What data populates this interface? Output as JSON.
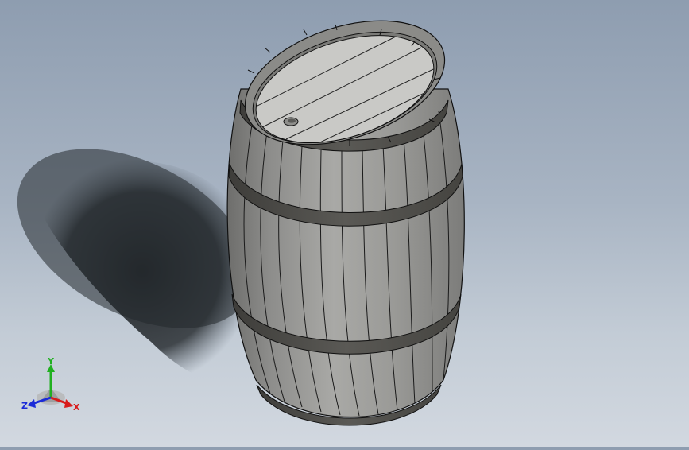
{
  "scene": {
    "model": "barrel",
    "view": "isometric",
    "colors": {
      "background_top": "#8e9db0",
      "background_bottom": "#d2d8e0",
      "shadow": "#1f2326",
      "wood_light": "#a3a3a1",
      "wood_mid": "#8a8a88",
      "wood_dark": "#6c6c6a",
      "lid": "#c9c9c6",
      "hoop": "#4a4945",
      "edge": "#111111"
    }
  },
  "triad": {
    "x_label": "X",
    "y_label": "Y",
    "z_label": "Z",
    "x_color": "#d81b1b",
    "y_color": "#20b020",
    "z_color": "#1b2bd8"
  }
}
